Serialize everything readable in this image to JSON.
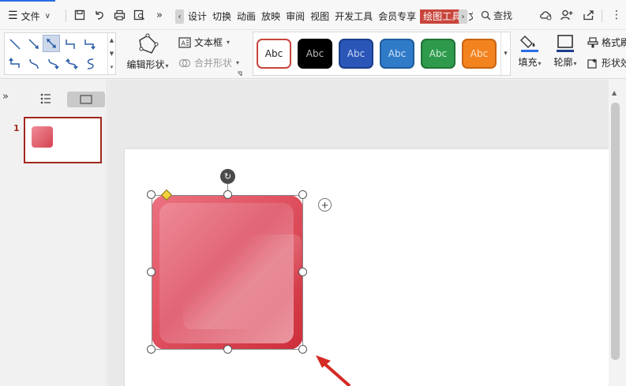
{
  "menu": {
    "file_label": "文件"
  },
  "tabs": [
    {
      "label": "设计",
      "active": false
    },
    {
      "label": "切换",
      "active": false
    },
    {
      "label": "动画",
      "active": false
    },
    {
      "label": "放映",
      "active": false
    },
    {
      "label": "审阅",
      "active": false
    },
    {
      "label": "视图",
      "active": false
    },
    {
      "label": "开发工具",
      "active": false
    },
    {
      "label": "会员专享",
      "active": false
    },
    {
      "label": "绘图工具",
      "active": true
    },
    {
      "label": "文",
      "active": false
    }
  ],
  "search": {
    "label": "查找"
  },
  "ribbon": {
    "edit_shape_label": "编辑形状",
    "text_box_label": "文本框",
    "merge_shape_label": "合并形状",
    "style_swatches": [
      {
        "text": "Abc",
        "fill": "#ffffff",
        "border": "#c8453b",
        "color": "#222222"
      },
      {
        "text": "Abc",
        "fill": "#000000",
        "border": "#000000",
        "color": "#bbbbbb"
      },
      {
        "text": "Abc",
        "fill": "#2a56b8",
        "border": "#1c3f8a",
        "color": "#c9d6f3"
      },
      {
        "text": "Abc",
        "fill": "#2f7bc8",
        "border": "#1f5c9a",
        "color": "#cfe2f5"
      },
      {
        "text": "Abc",
        "fill": "#2e9a4c",
        "border": "#1f7335",
        "color": "#d2ecd9"
      },
      {
        "text": "Abc",
        "fill": "#f2831f",
        "border": "#c86512",
        "color": "#fde3c7"
      }
    ],
    "fill_label": "填充",
    "outline_label": "轮廓",
    "format_painter_label": "格式刷",
    "shape_effect_label": "形状效"
  },
  "slides_panel": {
    "slide_number": "1"
  },
  "colors": {
    "accent_red": "#c8453b",
    "shape_fill": "#e25564",
    "adjust_handle": "#f1d23b",
    "annotation_arrow": "#d42a24"
  },
  "icons": {
    "file_menu": "hamburger-icon",
    "save": "save-icon",
    "undo": "undo-icon",
    "print": "print-icon",
    "print_preview": "print-preview-icon",
    "more": "double-chevron-icon",
    "search": "search-icon",
    "cloud": "cloud-icon",
    "user": "user-add-icon",
    "share": "share-icon",
    "menu": "more-vertical-icon",
    "rotate": "rotate-icon",
    "add": "plus-icon"
  }
}
